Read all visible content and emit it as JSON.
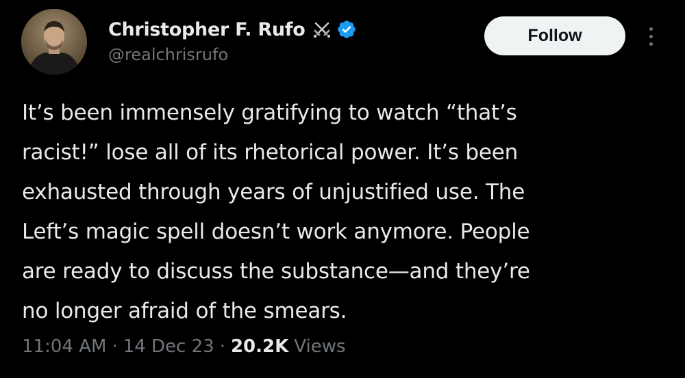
{
  "author": {
    "display_name": "Christopher F. Rufo",
    "handle": "@realchrisrufo",
    "badge_icon": "crossed-swords-icon",
    "verified_icon": "verified-badge-icon",
    "verified_color": "#1d9bf0"
  },
  "actions": {
    "follow_label": "Follow",
    "more_icon": "more-options-icon"
  },
  "tweet": {
    "lines": [
      "It’s been immensely gratifying to watch “that’s",
      "racist!” lose all of its rhetorical power. It’s been",
      "exhausted through years of unjustified use. The",
      "Left’s magic spell doesn’t work anymore. People",
      "are ready to discuss the substance—and they’re",
      "no longer afraid of the smears."
    ]
  },
  "meta": {
    "time": "11:04 AM",
    "separator": "·",
    "date": "14 Dec 23",
    "views_count": "20.2K",
    "views_label": "Views"
  },
  "colors": {
    "background": "#000000",
    "text_primary": "#e7e9ea",
    "text_secondary": "#71767b",
    "follow_bg": "#eff3f4",
    "follow_text": "#0f1419"
  }
}
